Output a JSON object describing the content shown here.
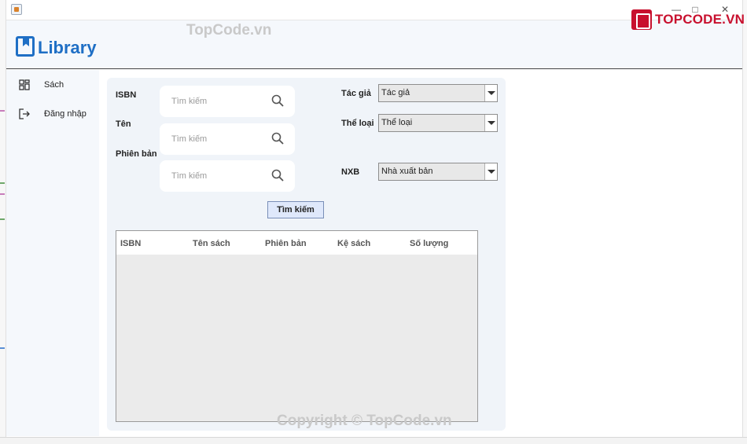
{
  "header": {
    "app_name": "Library"
  },
  "brand": {
    "logo_text": "TOPCODE.VN",
    "watermark_top": "TopCode.vn",
    "watermark_bottom": "Copyright © TopCode.vn"
  },
  "sidebar": {
    "items": [
      {
        "label": "Sách",
        "icon": "grid-icon"
      },
      {
        "label": "Đăng nhập",
        "icon": "login-icon"
      }
    ]
  },
  "search": {
    "isbn_label": "ISBN",
    "name_label": "Tên",
    "edition_label": "Phiên bản",
    "placeholder": "Tìm kiếm",
    "button_label": "Tìm kiếm"
  },
  "filters": {
    "author_label": "Tác giả",
    "author_value": "Tác giả",
    "category_label": "Thể loại",
    "category_value": "Thể loại",
    "publisher_label": "NXB",
    "publisher_value": "Nhà xuất bản"
  },
  "table": {
    "columns": [
      "ISBN",
      "Tên sách",
      "Phiên bản",
      "Kệ sách",
      "Số lượng"
    ],
    "rows": []
  },
  "colors": {
    "accent": "#1f6fc5",
    "brand_red": "#c8102e",
    "button_bg": "#dfe8fb"
  }
}
